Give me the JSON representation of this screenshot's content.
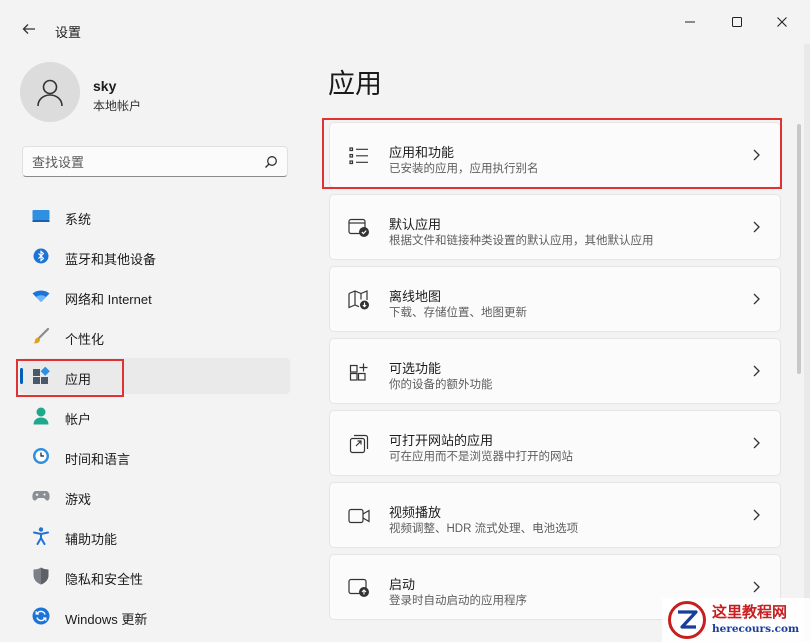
{
  "window": {
    "title": "设置"
  },
  "profile": {
    "name": "sky",
    "account_type": "本地帐户"
  },
  "search": {
    "placeholder": "查找设置"
  },
  "nav": {
    "items": [
      {
        "label": "系统",
        "icon": "system-display-icon"
      },
      {
        "label": "蓝牙和其他设备",
        "icon": "bluetooth-icon"
      },
      {
        "label": "网络和 Internet",
        "icon": "wifi-icon"
      },
      {
        "label": "个性化",
        "icon": "brush-icon"
      },
      {
        "label": "应用",
        "icon": "apps-icon",
        "selected": true
      },
      {
        "label": "帐户",
        "icon": "account-icon"
      },
      {
        "label": "时间和语言",
        "icon": "clock-globe-icon"
      },
      {
        "label": "游戏",
        "icon": "gamepad-icon"
      },
      {
        "label": "辅助功能",
        "icon": "accessibility-icon"
      },
      {
        "label": "隐私和安全性",
        "icon": "shield-icon"
      },
      {
        "label": "Windows 更新",
        "icon": "windows-update-icon"
      }
    ]
  },
  "page": {
    "title": "应用"
  },
  "cards": [
    {
      "title": "应用和功能",
      "subtitle": "已安装的应用，应用执行别名",
      "icon": "list-icon"
    },
    {
      "title": "默认应用",
      "subtitle": "根据文件和链接种类设置的默认应用，其他默认应用",
      "icon": "default-apps-icon"
    },
    {
      "title": "离线地图",
      "subtitle": "下载、存储位置、地图更新",
      "icon": "offline-map-icon"
    },
    {
      "title": "可选功能",
      "subtitle": "你的设备的额外功能",
      "icon": "optional-features-icon"
    },
    {
      "title": "可打开网站的应用",
      "subtitle": "可在应用而不是浏览器中打开的网站",
      "icon": "open-in-app-icon"
    },
    {
      "title": "视频播放",
      "subtitle": "视频调整、HDR 流式处理、电池选项",
      "icon": "video-camera-icon"
    },
    {
      "title": "启动",
      "subtitle": "登录时自动启动的应用程序",
      "icon": "startup-icon"
    }
  ],
  "watermark": {
    "title": "这里教程网",
    "url": "herecours.com"
  },
  "colors": {
    "accent": "#005fb8",
    "highlight": "#e03232",
    "background": "#f3f3f3"
  }
}
